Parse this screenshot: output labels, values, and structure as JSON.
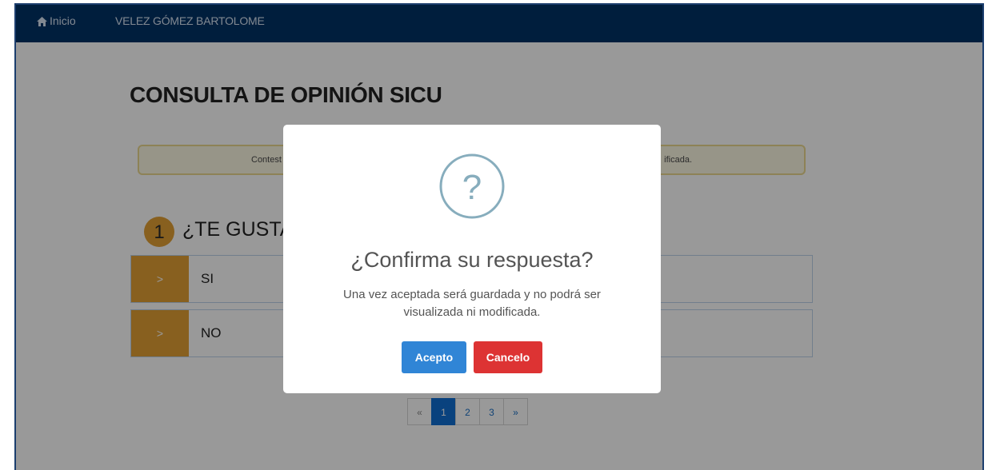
{
  "navbar": {
    "home_label": "Inicio",
    "user_name": "VELEZ GÓMEZ BARTOLOME",
    "background": "#003366"
  },
  "page": {
    "title": "CONSULTA DE OPINIÓN SICU",
    "notice_left": "Contest",
    "notice_right": "ificada."
  },
  "question": {
    "number": "1",
    "text": "¿TE GUSTA",
    "options": [
      {
        "handle": ">",
        "label": "SI"
      },
      {
        "handle": ">",
        "label": "NO"
      }
    ],
    "accent": "#e3a135"
  },
  "pagination": {
    "prev": "«",
    "pages": [
      "1",
      "2",
      "3"
    ],
    "current": "1",
    "next": "»"
  },
  "modal": {
    "icon": "question-icon",
    "icon_glyph": "?",
    "title": "¿Confirma su respuesta?",
    "text": "Una vez aceptada será guardada y no podrá ser visualizada ni modificada.",
    "confirm_label": "Acepto",
    "cancel_label": "Cancelo",
    "confirm_color": "#3085d6",
    "cancel_color": "#dd3333"
  }
}
